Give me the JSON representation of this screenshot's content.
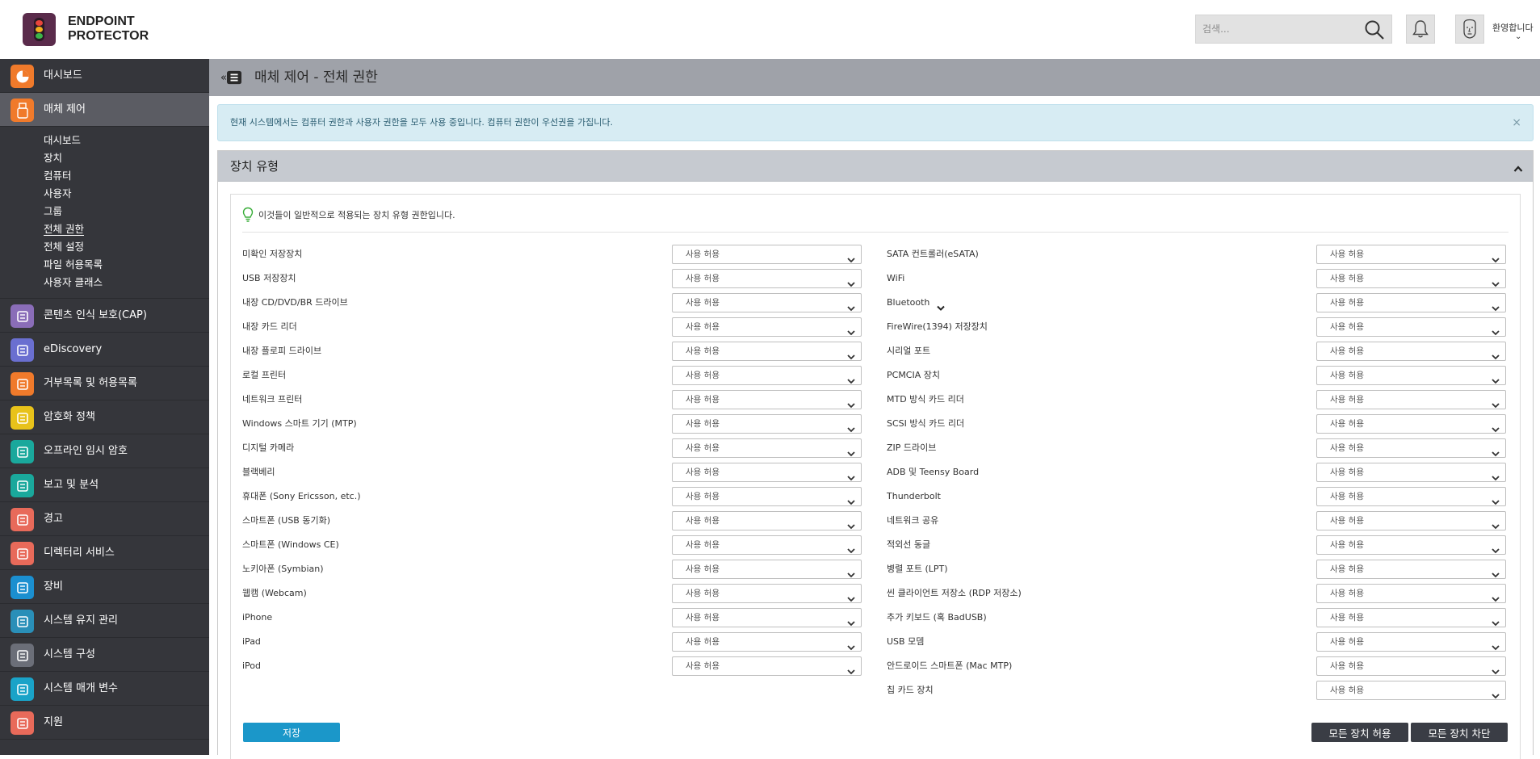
{
  "brand": {
    "line1": "ENDPOINT",
    "line2": "PROTECTOR"
  },
  "header": {
    "search_placeholder": "검색...",
    "welcome": "환영합니다"
  },
  "sidebar": {
    "items": [
      {
        "label": "대시보드",
        "icon": "dashboard-icon",
        "color": "#f07a2b"
      },
      {
        "label": "매체 제어",
        "icon": "usb-icon",
        "color": "#f07a2b"
      },
      {
        "label": "콘텐츠 인식 보호(CAP)",
        "icon": "document-shield-icon",
        "color": "#8a6db8"
      },
      {
        "label": "eDiscovery",
        "icon": "telescope-icon",
        "color": "#6a6fd0"
      },
      {
        "label": "거부목록 및 허용목록",
        "icon": "list-window-icon",
        "color": "#f07a2b"
      },
      {
        "label": "암호화 정책",
        "icon": "gear-lock-icon",
        "color": "#e8c21a"
      },
      {
        "label": "오프라인 임시 암호",
        "icon": "remote-icon",
        "color": "#1aa89c"
      },
      {
        "label": "보고 및 분석",
        "icon": "chart-icon",
        "color": "#1aa89c"
      },
      {
        "label": "경고",
        "icon": "warning-icon",
        "color": "#e86a5a"
      },
      {
        "label": "디렉터리 서비스",
        "icon": "directory-icon",
        "color": "#e86a5a"
      },
      {
        "label": "장비",
        "icon": "appliance-icon",
        "color": "#1b8fd0"
      },
      {
        "label": "시스템 유지 관리",
        "icon": "tools-icon",
        "color": "#2a8fb8"
      },
      {
        "label": "시스템 구성",
        "icon": "gear-icon",
        "color": "#6b6e78"
      },
      {
        "label": "시스템 매개 변수",
        "icon": "list-icon",
        "color": "#1aa3c8"
      },
      {
        "label": "지원",
        "icon": "lifebuoy-icon",
        "color": "#e86a5a"
      }
    ],
    "subitems": [
      "대시보드",
      "장치",
      "컴퓨터",
      "사용자",
      "그룹",
      "전체 권한",
      "전체 설정",
      "파일 허용목록",
      "사용자 클래스"
    ]
  },
  "page": {
    "title": "매체 제어 - 전체 권한",
    "alert": "현재 시스템에서는 컴퓨터 권한과 사용자 권한을 모두 사용 중입니다. 컴퓨터 권한이 우선권을 가집니다.",
    "alert_close": "×",
    "panel_title": "장치 유형",
    "hint": "이것들이 일반적으로 적용되는 장치 유형 권한입니다.",
    "permission_value": "사용 허용",
    "left_devices": [
      "미확인 저장장치",
      "USB 저장장치",
      "내장 CD/DVD/BR 드라이브",
      "내장 카드 리더",
      "내장 플로피 드라이브",
      "로컬 프린터",
      "네트워크 프린터",
      "Windows 스마트 기기 (MTP)",
      "디지털 카메라",
      "블랙베리",
      "휴대폰 (Sony Ericsson, etc.)",
      "스마트폰 (USB 동기화)",
      "스마트폰 (Windows CE)",
      "노키아폰 (Symbian)",
      "웹캠 (Webcam)",
      "iPhone",
      "iPad",
      "iPod"
    ],
    "right_devices": [
      "SATA 컨트롤러(eSATA)",
      "WiFi",
      "Bluetooth",
      "FireWire(1394) 저장장치",
      "시리얼 포트",
      "PCMCIA 장치",
      "MTD 방식 카드 리더",
      "SCSI 방식 카드 리더",
      "ZIP 드라이브",
      "ADB 및 Teensy Board",
      "Thunderbolt",
      "네트워크 공유",
      "적외선 동글",
      "병렬 포트 (LPT)",
      "씬 클라이언트 저장소 (RDP 저장소)",
      "추가 키보드 (혹 BadUSB)",
      "USB 모뎀",
      "안드로이드 스마트폰 (Mac MTP)",
      "칩 카드 장치"
    ],
    "save_label": "저장",
    "allow_all_label": "모든 장치 허용",
    "block_all_label": "모든 장치 차단"
  }
}
